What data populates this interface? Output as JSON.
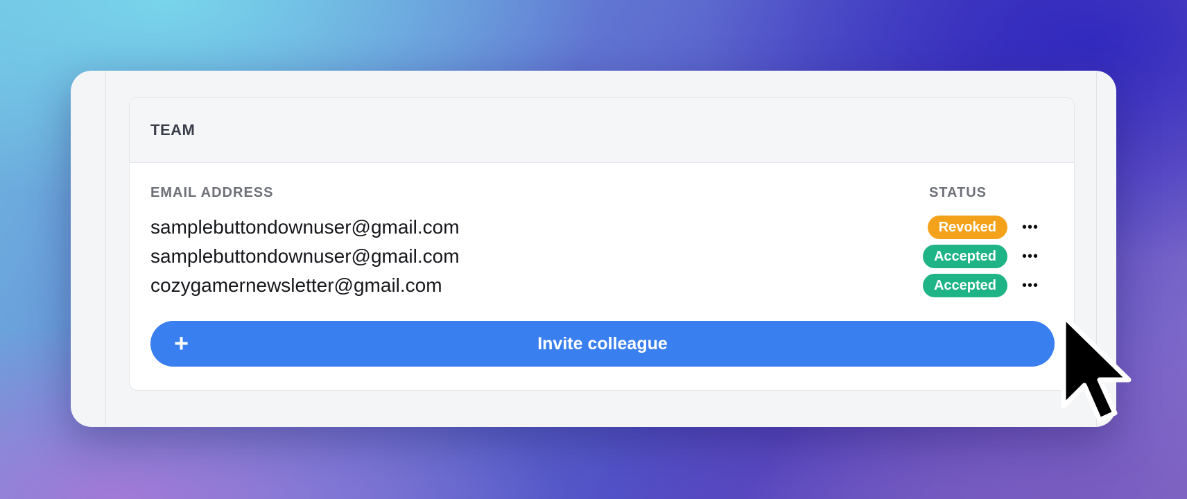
{
  "team": {
    "title": "TEAM",
    "columns": {
      "email": "EMAIL ADDRESS",
      "status": "STATUS"
    },
    "members": [
      {
        "email": "samplebuttondownuser@gmail.com",
        "status": "Revoked",
        "status_color": "#f4a21c",
        "more": "•••"
      },
      {
        "email": "samplebuttondownuser@gmail.com",
        "status": "Accepted",
        "status_color": "#1fb485",
        "more": "•••"
      },
      {
        "email": "cozygamernewsletter@gmail.com",
        "status": "Accepted",
        "status_color": "#1fb485",
        "more": "•••"
      }
    ],
    "invite_button": {
      "icon": "plus-icon",
      "icon_glyph": "+",
      "label": "Invite colleague",
      "color": "#3a7ff0"
    }
  },
  "cursor": {
    "icon": "mouse-pointer-icon"
  }
}
